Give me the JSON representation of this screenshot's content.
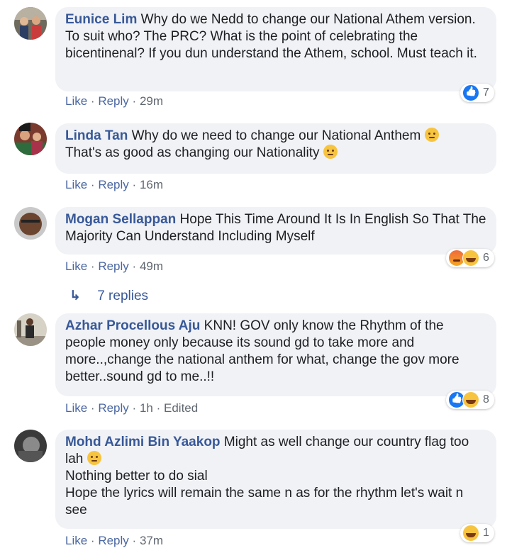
{
  "comments": [
    {
      "author": "Eunice Lim",
      "text": "Why do we Nedd to change our National Athem version. To suit who? The PRC? What is the point of celebrating the bicentinenal? If you dun understand the Athem, school. Must teach it.",
      "like_label": "Like",
      "reply_label": "Reply",
      "time": "29m",
      "reaction_count": "7",
      "reactions": [
        "like"
      ]
    },
    {
      "author": "Linda Tan",
      "text": "Why do we need to change our National Anthem",
      "text2": "That's as good as changing our Nationality",
      "like_label": "Like",
      "reply_label": "Reply",
      "time": "16m"
    },
    {
      "author": "Mogan Sellappan",
      "text": "Hope This Time Around It Is In English So That The Majority Can Understand Including Myself",
      "like_label": "Like",
      "reply_label": "Reply",
      "time": "49m",
      "reaction_count": "6",
      "reactions": [
        "angry",
        "haha"
      ]
    },
    {
      "author": "Azhar Procellous Aju",
      "text": "KNN! GOV only know the Rhythm of the people money only because its sound gd to take more and more..,change the national anthem for what, change the gov more better..sound gd to me..!!",
      "like_label": "Like",
      "reply_label": "Reply",
      "time": "1h",
      "edited_label": "Edited",
      "reaction_count": "8",
      "reactions": [
        "like",
        "haha"
      ]
    },
    {
      "author": "Mohd Azlimi Bin Yaakop",
      "text": "Might as well change our country flag too lah",
      "line2": "Nothing better to do sial",
      "line3": "Hope the lyrics will remain the same n as for the rhythm let's wait n see",
      "like_label": "Like",
      "reply_label": "Reply",
      "time": "37m",
      "reaction_count": "1",
      "reactions": [
        "haha"
      ]
    }
  ],
  "replies_link": "7 replies",
  "separator": "·"
}
